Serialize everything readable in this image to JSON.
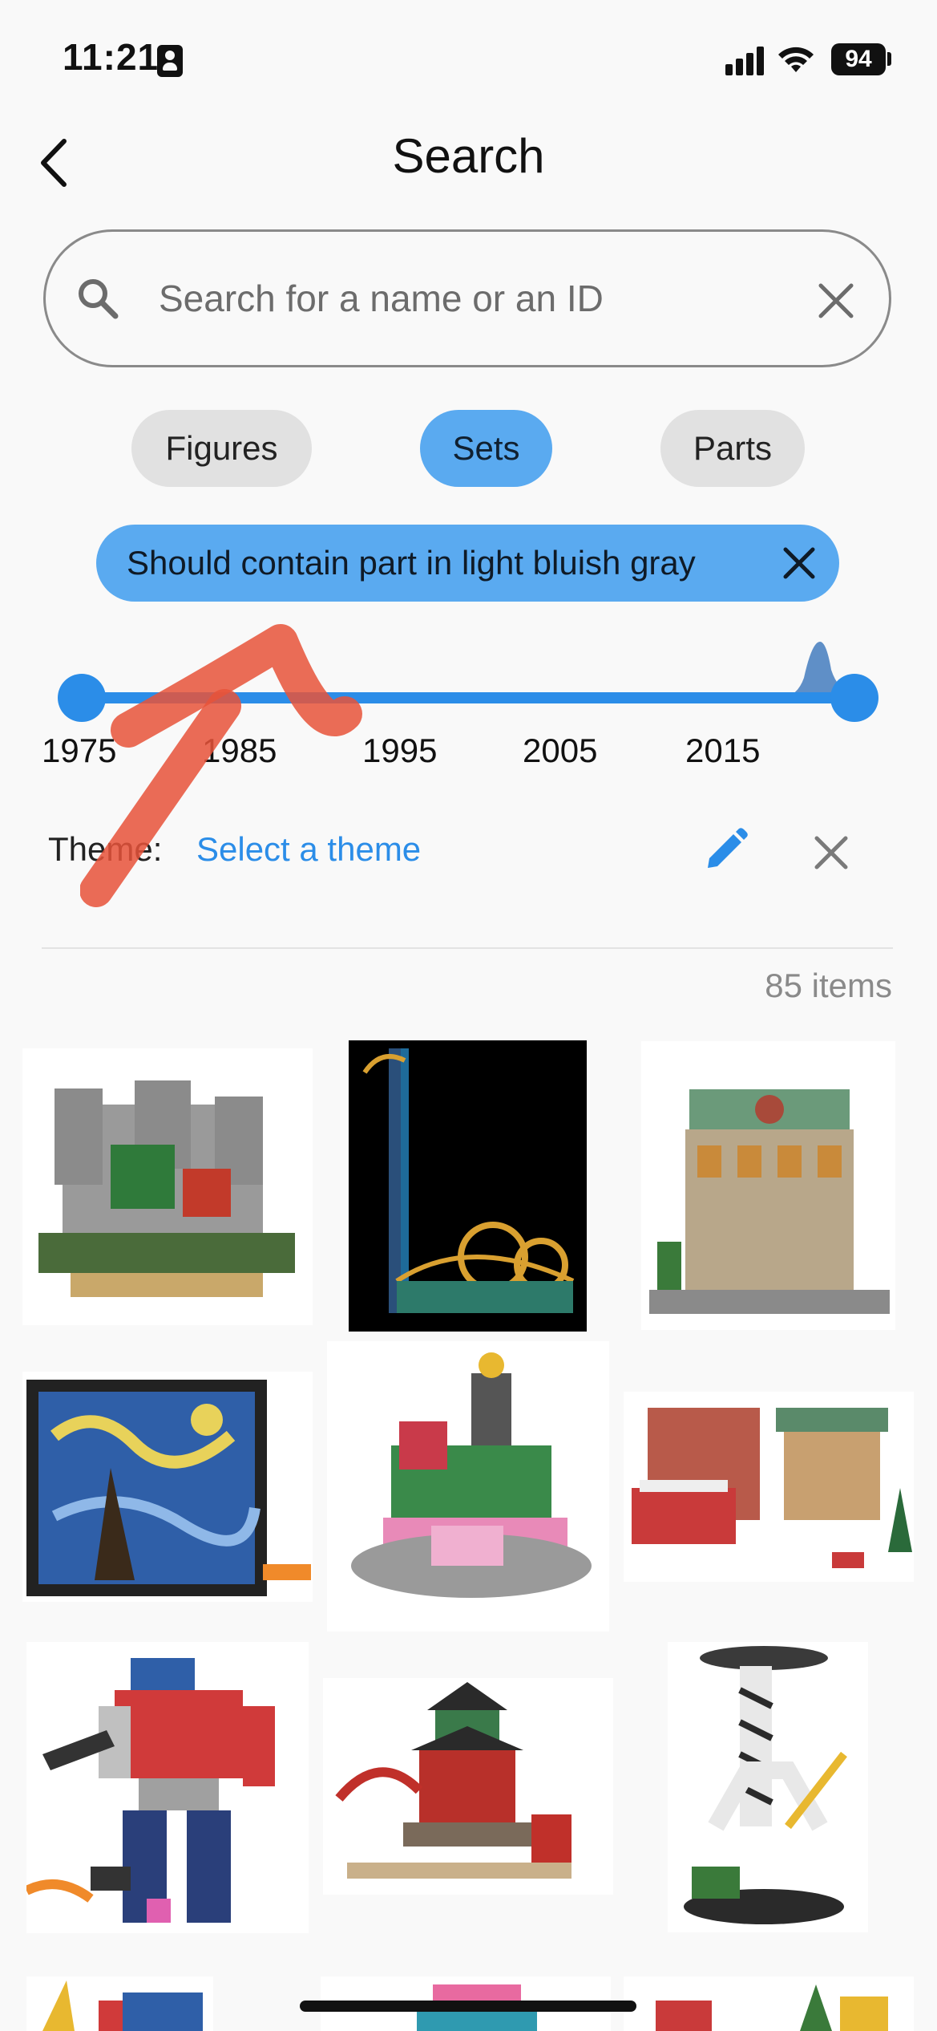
{
  "status_bar": {
    "time": "11:21",
    "battery": "94"
  },
  "header": {
    "title": "Search"
  },
  "search": {
    "placeholder": "Search for a name or an ID",
    "value": ""
  },
  "categories": [
    {
      "label": "Figures",
      "active": false
    },
    {
      "label": "Sets",
      "active": true
    },
    {
      "label": "Parts",
      "active": false
    }
  ],
  "filter_chip": {
    "label": "Should contain part in light bluish gray"
  },
  "year_slider": {
    "ticks": [
      "1975",
      "1985",
      "1995",
      "2005",
      "2015"
    ],
    "min_selected": "1975",
    "max_selected": "2023"
  },
  "theme": {
    "label": "Theme:",
    "link": "Select a theme"
  },
  "results": {
    "count": "85 items"
  },
  "colors": {
    "accent": "#2b8de8",
    "chip_active": "#5aaaf0",
    "chip_inactive": "#e1e1e1",
    "annotation": "#e8533a"
  },
  "icons": [
    "id-card-icon",
    "signal-icon",
    "wifi-icon",
    "battery-icon",
    "back-chevron-icon",
    "search-icon",
    "clear-icon",
    "close-icon",
    "pencil-icon"
  ]
}
